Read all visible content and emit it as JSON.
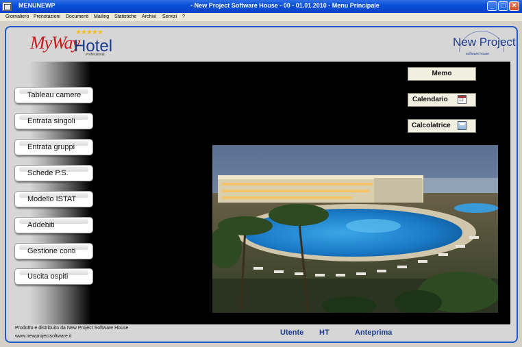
{
  "window": {
    "exe_name": "MENUNEWP",
    "title": "- New Project Software House - 00 - 01.01.2010 - Menu Principale"
  },
  "menu": [
    "Giornaliero",
    "Prenotazioni",
    "Documenti",
    "Mailing",
    "Statistiche",
    "Archivi",
    "Servizi",
    "?"
  ],
  "branding": {
    "logo_myway": "MyWay",
    "logo_hotel": "Hotel",
    "logo_edition": "Professional",
    "vendor_logo": "New Project",
    "vendor_sub": "software house"
  },
  "nav": [
    {
      "label": "Tableau camere"
    },
    {
      "label": "Entrata singoli"
    },
    {
      "label": "Entrata gruppi"
    },
    {
      "label": "Schede P.S."
    },
    {
      "label": "Modello ISTAT"
    },
    {
      "label": "Addebiti"
    },
    {
      "label": "Gestione conti"
    },
    {
      "label": "Uscita ospiti"
    }
  ],
  "tools": {
    "memo": "Memo",
    "calendario": "Calendario",
    "calendar_icon_text": "12",
    "calcolatrice": "Calcolatrice"
  },
  "footer": {
    "credit": "Prodotto e distribuito da New Project Software House",
    "url": "www.newprojectsoftware.it"
  },
  "status": {
    "utente_label": "Utente",
    "user": "HT",
    "anteprima": "Anteprima"
  },
  "icons": {
    "app": "app-window-icon",
    "calendar": "calendar-icon",
    "calculator": "calculator-icon",
    "stars": "★★★★★"
  }
}
